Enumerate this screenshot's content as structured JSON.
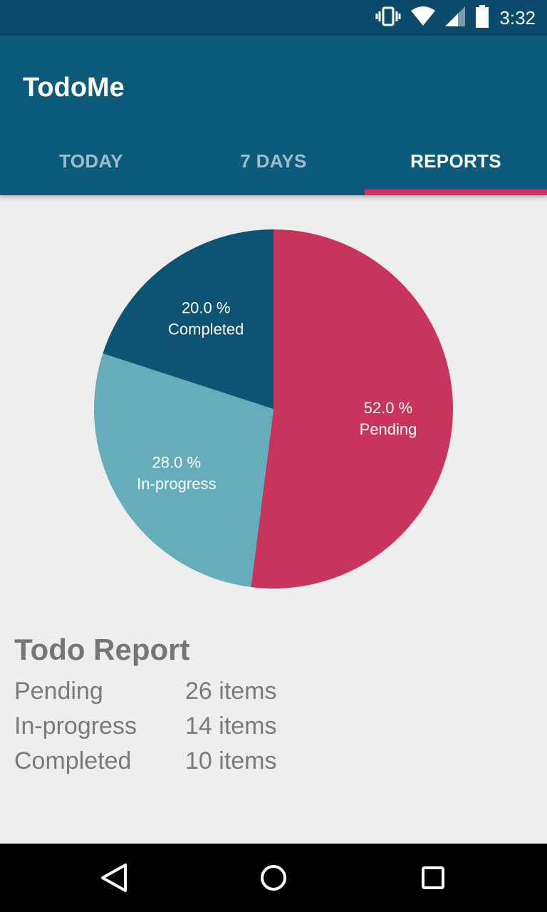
{
  "status_bar": {
    "time": "3:32"
  },
  "app_bar": {
    "title": "TodoMe"
  },
  "tabs": [
    {
      "label": "TODAY",
      "active": false
    },
    {
      "label": "7 DAYS",
      "active": false
    },
    {
      "label": "REPORTS",
      "active": true
    }
  ],
  "colors": {
    "primary": "#0d5b7b",
    "status_bar": "#0b4a6a",
    "accent": "#d03560",
    "pending": "#c8345c",
    "in_progress": "#66adbc",
    "completed": "#0d5474"
  },
  "chart_data": {
    "type": "pie",
    "slices": [
      {
        "label": "Pending",
        "value": 52.0,
        "display": "52.0 %",
        "color": "#c8345c"
      },
      {
        "label": "In-progress",
        "value": 28.0,
        "display": "28.0 %",
        "color": "#66adbc"
      },
      {
        "label": "Completed",
        "value": 20.0,
        "display": "20.0 %",
        "color": "#0d5474"
      }
    ]
  },
  "report": {
    "title": "Todo Report",
    "rows": [
      {
        "label": "Pending",
        "value": "26 items"
      },
      {
        "label": "In-progress",
        "value": "14 items"
      },
      {
        "label": "Completed",
        "value": "10 items"
      }
    ]
  },
  "nav_bar": {
    "icons": [
      "back-icon",
      "home-icon",
      "recents-icon"
    ]
  }
}
